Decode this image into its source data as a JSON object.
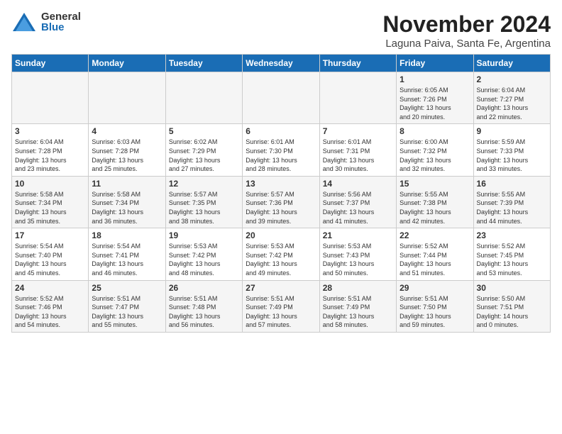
{
  "logo": {
    "general": "General",
    "blue": "Blue"
  },
  "header": {
    "month": "November 2024",
    "location": "Laguna Paiva, Santa Fe, Argentina"
  },
  "weekdays": [
    "Sunday",
    "Monday",
    "Tuesday",
    "Wednesday",
    "Thursday",
    "Friday",
    "Saturday"
  ],
  "weeks": [
    [
      {
        "day": "",
        "info": ""
      },
      {
        "day": "",
        "info": ""
      },
      {
        "day": "",
        "info": ""
      },
      {
        "day": "",
        "info": ""
      },
      {
        "day": "",
        "info": ""
      },
      {
        "day": "1",
        "info": "Sunrise: 6:05 AM\nSunset: 7:26 PM\nDaylight: 13 hours\nand 20 minutes."
      },
      {
        "day": "2",
        "info": "Sunrise: 6:04 AM\nSunset: 7:27 PM\nDaylight: 13 hours\nand 22 minutes."
      }
    ],
    [
      {
        "day": "3",
        "info": "Sunrise: 6:04 AM\nSunset: 7:28 PM\nDaylight: 13 hours\nand 23 minutes."
      },
      {
        "day": "4",
        "info": "Sunrise: 6:03 AM\nSunset: 7:28 PM\nDaylight: 13 hours\nand 25 minutes."
      },
      {
        "day": "5",
        "info": "Sunrise: 6:02 AM\nSunset: 7:29 PM\nDaylight: 13 hours\nand 27 minutes."
      },
      {
        "day": "6",
        "info": "Sunrise: 6:01 AM\nSunset: 7:30 PM\nDaylight: 13 hours\nand 28 minutes."
      },
      {
        "day": "7",
        "info": "Sunrise: 6:01 AM\nSunset: 7:31 PM\nDaylight: 13 hours\nand 30 minutes."
      },
      {
        "day": "8",
        "info": "Sunrise: 6:00 AM\nSunset: 7:32 PM\nDaylight: 13 hours\nand 32 minutes."
      },
      {
        "day": "9",
        "info": "Sunrise: 5:59 AM\nSunset: 7:33 PM\nDaylight: 13 hours\nand 33 minutes."
      }
    ],
    [
      {
        "day": "10",
        "info": "Sunrise: 5:58 AM\nSunset: 7:34 PM\nDaylight: 13 hours\nand 35 minutes."
      },
      {
        "day": "11",
        "info": "Sunrise: 5:58 AM\nSunset: 7:34 PM\nDaylight: 13 hours\nand 36 minutes."
      },
      {
        "day": "12",
        "info": "Sunrise: 5:57 AM\nSunset: 7:35 PM\nDaylight: 13 hours\nand 38 minutes."
      },
      {
        "day": "13",
        "info": "Sunrise: 5:57 AM\nSunset: 7:36 PM\nDaylight: 13 hours\nand 39 minutes."
      },
      {
        "day": "14",
        "info": "Sunrise: 5:56 AM\nSunset: 7:37 PM\nDaylight: 13 hours\nand 41 minutes."
      },
      {
        "day": "15",
        "info": "Sunrise: 5:55 AM\nSunset: 7:38 PM\nDaylight: 13 hours\nand 42 minutes."
      },
      {
        "day": "16",
        "info": "Sunrise: 5:55 AM\nSunset: 7:39 PM\nDaylight: 13 hours\nand 44 minutes."
      }
    ],
    [
      {
        "day": "17",
        "info": "Sunrise: 5:54 AM\nSunset: 7:40 PM\nDaylight: 13 hours\nand 45 minutes."
      },
      {
        "day": "18",
        "info": "Sunrise: 5:54 AM\nSunset: 7:41 PM\nDaylight: 13 hours\nand 46 minutes."
      },
      {
        "day": "19",
        "info": "Sunrise: 5:53 AM\nSunset: 7:42 PM\nDaylight: 13 hours\nand 48 minutes."
      },
      {
        "day": "20",
        "info": "Sunrise: 5:53 AM\nSunset: 7:42 PM\nDaylight: 13 hours\nand 49 minutes."
      },
      {
        "day": "21",
        "info": "Sunrise: 5:53 AM\nSunset: 7:43 PM\nDaylight: 13 hours\nand 50 minutes."
      },
      {
        "day": "22",
        "info": "Sunrise: 5:52 AM\nSunset: 7:44 PM\nDaylight: 13 hours\nand 51 minutes."
      },
      {
        "day": "23",
        "info": "Sunrise: 5:52 AM\nSunset: 7:45 PM\nDaylight: 13 hours\nand 53 minutes."
      }
    ],
    [
      {
        "day": "24",
        "info": "Sunrise: 5:52 AM\nSunset: 7:46 PM\nDaylight: 13 hours\nand 54 minutes."
      },
      {
        "day": "25",
        "info": "Sunrise: 5:51 AM\nSunset: 7:47 PM\nDaylight: 13 hours\nand 55 minutes."
      },
      {
        "day": "26",
        "info": "Sunrise: 5:51 AM\nSunset: 7:48 PM\nDaylight: 13 hours\nand 56 minutes."
      },
      {
        "day": "27",
        "info": "Sunrise: 5:51 AM\nSunset: 7:49 PM\nDaylight: 13 hours\nand 57 minutes."
      },
      {
        "day": "28",
        "info": "Sunrise: 5:51 AM\nSunset: 7:49 PM\nDaylight: 13 hours\nand 58 minutes."
      },
      {
        "day": "29",
        "info": "Sunrise: 5:51 AM\nSunset: 7:50 PM\nDaylight: 13 hours\nand 59 minutes."
      },
      {
        "day": "30",
        "info": "Sunrise: 5:50 AM\nSunset: 7:51 PM\nDaylight: 14 hours\nand 0 minutes."
      }
    ]
  ]
}
